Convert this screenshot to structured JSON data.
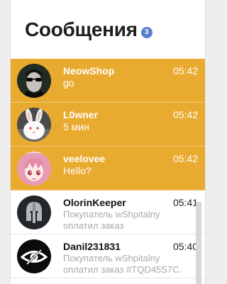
{
  "header": {
    "title": "Сообщения",
    "unread_count": "3"
  },
  "colors": {
    "unread_background": "#e8ab30",
    "badge": "#5b7fd0"
  },
  "conversations": [
    {
      "name": "NeowShop",
      "time": "05:42",
      "preview": "go",
      "unread": true,
      "avatar_icon": "sunglasses-man-avatar"
    },
    {
      "name": "L0wner",
      "time": "05:42",
      "preview": "5 мин",
      "unread": true,
      "avatar_icon": "white-rabbit-avatar"
    },
    {
      "name": "veelovee",
      "time": "05:42",
      "preview": "Hello?",
      "unread": true,
      "avatar_icon": "anime-girl-avatar"
    },
    {
      "name": "OlorinKeeper",
      "time": "05:41",
      "preview": "Покупатель wShpitalny оплатил заказ",
      "unread": false,
      "avatar_icon": "spartan-helmet-avatar"
    },
    {
      "name": "Danil231831",
      "time": "05:40",
      "preview": "Покупатель wShpitalny оплатил заказ #TQD45S7C.",
      "unread": false,
      "avatar_icon": "eye-logo-avatar"
    }
  ]
}
